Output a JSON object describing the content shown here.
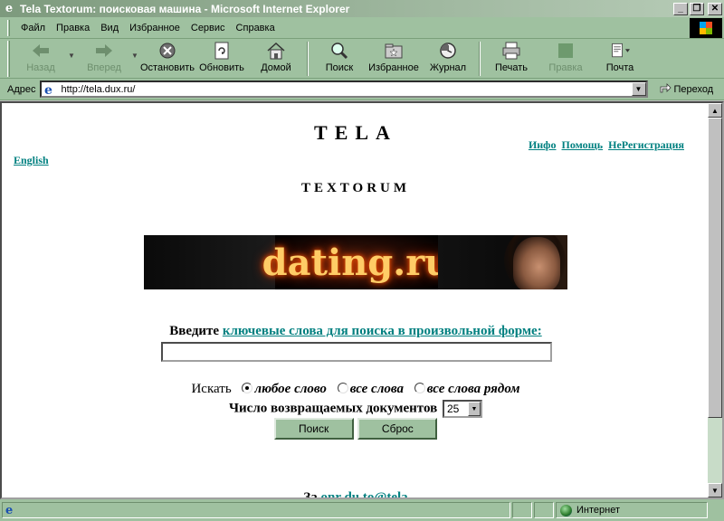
{
  "window": {
    "title": "Tela Textorum: поисковая машина - Microsoft Internet Explorer"
  },
  "menu": [
    "Файл",
    "Правка",
    "Вид",
    "Избранное",
    "Сервис",
    "Справка"
  ],
  "menu_hotkeys": [
    "Ф",
    "П",
    "В",
    "И",
    "С",
    "С"
  ],
  "toolbar": {
    "back": "Назад",
    "forward": "Вперед",
    "stop": "Остановить",
    "refresh": "Обновить",
    "home": "Домой",
    "search": "Поиск",
    "favorites": "Избранное",
    "history": "Журнал",
    "print": "Печать",
    "edit": "Правка",
    "mail": "Почта"
  },
  "address": {
    "label": "Адрес",
    "url": "http://tela.dux.ru/",
    "go": "Переход"
  },
  "page": {
    "title": "TELA",
    "subtitle": "TEXTORUM",
    "links": {
      "info": "Инфо",
      "help": "Помощь",
      "register": "НеРегистрация",
      "english": "English"
    },
    "banner": {
      "text": "dating.ru"
    },
    "prompt_prefix": "Введите ",
    "prompt_link": "ключевые слова для поиска в произвольной форме:",
    "query_value": "",
    "mode_label": "Искать",
    "modes": [
      "любое слово",
      "все слова",
      "все слова рядом"
    ],
    "selected_mode": 0,
    "count_label": "Число возвращаемых документов",
    "count_value": "25",
    "search_button": "Поиск",
    "reset_button": "Сброс",
    "bottom_prefix": "За",
    "bottom_link": "onr  du  to@tela"
  },
  "status": {
    "text": "",
    "zone": "Интернет"
  }
}
